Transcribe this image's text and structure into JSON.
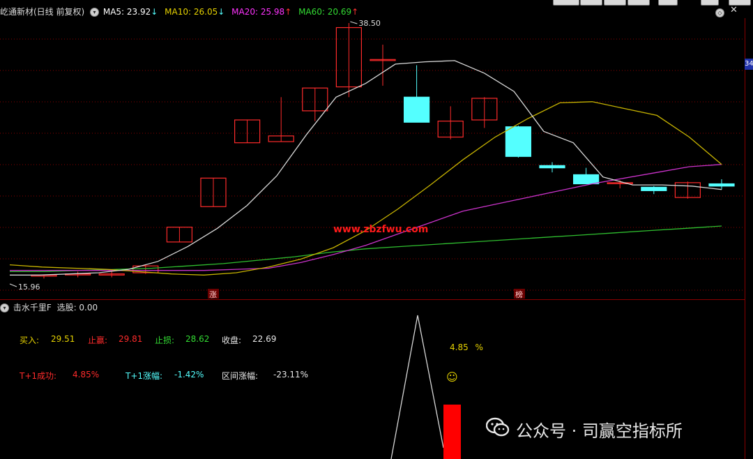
{
  "header": {
    "stock_name": "屹通新材(日线 前复权)",
    "ma": [
      {
        "label": "MA5:",
        "value": "23.92",
        "arrow": "↓",
        "color": "#ffffff"
      },
      {
        "label": "MA10:",
        "value": "26.05",
        "arrow": "↓",
        "color": "#e6d200"
      },
      {
        "label": "MA20:",
        "value": "25.98",
        "arrow": "↑",
        "color": "#ff33ff"
      },
      {
        "label": "MA60:",
        "value": "20.69",
        "arrow": "↑",
        "color": "#33dd33"
      }
    ]
  },
  "chart_data": {
    "type": "candlestick",
    "high_label": "38.50",
    "low_label": "15.96",
    "right_axis_label": "34",
    "watermark_url": "www.zbzfwu.com",
    "markers": [
      "涨",
      "榜"
    ],
    "candles": [
      {
        "o": 16.3,
        "h": 16.4,
        "l": 16.1,
        "c": 16.4
      },
      {
        "o": 16.5,
        "h": 16.7,
        "l": 16.2,
        "c": 16.5
      },
      {
        "o": 16.4,
        "h": 16.8,
        "l": 16.2,
        "c": 16.5
      },
      {
        "o": 16.6,
        "h": 17.3,
        "l": 16.5,
        "c": 17.2
      },
      {
        "o": 19.3,
        "h": 20.6,
        "l": 19.3,
        "c": 20.6
      },
      {
        "o": 22.4,
        "h": 24.9,
        "l": 22.4,
        "c": 24.9
      },
      {
        "o": 28.0,
        "h": 30.0,
        "l": 28.0,
        "c": 30.0
      },
      {
        "o": 28.1,
        "h": 32.0,
        "l": 28.1,
        "c": 28.6
      },
      {
        "o": 30.8,
        "h": 32.8,
        "l": 29.9,
        "c": 32.8
      },
      {
        "o": 32.9,
        "h": 38.5,
        "l": 32.0,
        "c": 38.1
      },
      {
        "o": 35.3,
        "h": 36.6,
        "l": 33.0,
        "c": 35.3
      },
      {
        "o": 32.0,
        "h": 34.8,
        "l": 29.9,
        "c": 29.8
      },
      {
        "o": 28.5,
        "h": 31.2,
        "l": 28.3,
        "c": 29.9
      },
      {
        "o": 30.0,
        "h": 32.0,
        "l": 29.3,
        "c": 31.9
      },
      {
        "o": 29.4,
        "h": 29.5,
        "l": 26.7,
        "c": 26.8
      },
      {
        "o": 26.0,
        "h": 26.3,
        "l": 25.4,
        "c": 25.8
      },
      {
        "o": 25.2,
        "h": 25.8,
        "l": 24.5,
        "c": 24.4
      },
      {
        "o": 24.5,
        "h": 24.7,
        "l": 24.0,
        "c": 24.5
      },
      {
        "o": 24.1,
        "h": 24.2,
        "l": 23.5,
        "c": 23.8
      },
      {
        "o": 23.2,
        "h": 24.6,
        "l": 23.1,
        "c": 24.5
      },
      {
        "o": 24.4,
        "h": 24.8,
        "l": 23.9,
        "c": 24.2
      }
    ],
    "ma5": [
      16.4,
      16.4,
      16.5,
      16.6,
      16.9,
      17.6,
      18.9,
      20.5,
      22.5,
      25.1,
      28.7,
      32.0,
      33.2,
      34.9,
      35.1,
      35.2,
      34.1,
      32.5,
      29.0,
      28.0,
      25.0,
      24.3,
      24.3,
      24.2,
      23.9
    ],
    "ma10": [
      17.3,
      17.1,
      17.0,
      16.9,
      16.7,
      16.5,
      16.4,
      16.6,
      17.1,
      17.8,
      18.8,
      20.3,
      22.2,
      24.3,
      26.5,
      28.5,
      30.1,
      31.5,
      31.6,
      31.0,
      30.4,
      28.5,
      26.1
    ],
    "ma20": [
      16.8,
      16.8,
      16.8,
      16.8,
      16.8,
      16.8,
      16.8,
      16.9,
      17.0,
      17.5,
      18.2,
      19.0,
      20.0,
      21.0,
      22.0,
      22.6,
      23.2,
      23.8,
      24.4,
      24.9,
      25.4,
      25.9,
      26.1
    ],
    "ma60": [
      16.7,
      16.7,
      16.8,
      16.9,
      17.0,
      17.2,
      17.4,
      17.7,
      18.0,
      18.4,
      18.7,
      18.9,
      19.1,
      19.3,
      19.5,
      19.7,
      19.9,
      20.1,
      20.3,
      20.5,
      20.7
    ]
  },
  "indicator": {
    "title": "击水千里F",
    "subtitle": "选股: 0.00",
    "buy_label": "买入:",
    "buy_value": "29.51",
    "target_label": "止赢:",
    "target_value": "29.81",
    "stop_label": "止损:",
    "stop_value": "28.62",
    "close_label": "收盘:",
    "close_value": "22.69",
    "t1_success_label": "T+1成功:",
    "t1_success_value": "4.85%",
    "t1_change_label": "T+1涨幅:",
    "t1_change_value": "-1.42%",
    "range_label": "区间涨幅:",
    "range_value": "-23.11%",
    "signal_value": "4.85",
    "signal_unit": "%",
    "emoji": "☺"
  },
  "watermark": {
    "text": "公众号 · 司赢空指标所"
  },
  "colors": {
    "up": "#ff2b2b",
    "down": "#54ffff",
    "grid": "#8b0000",
    "accent_red": "#ff0000"
  }
}
